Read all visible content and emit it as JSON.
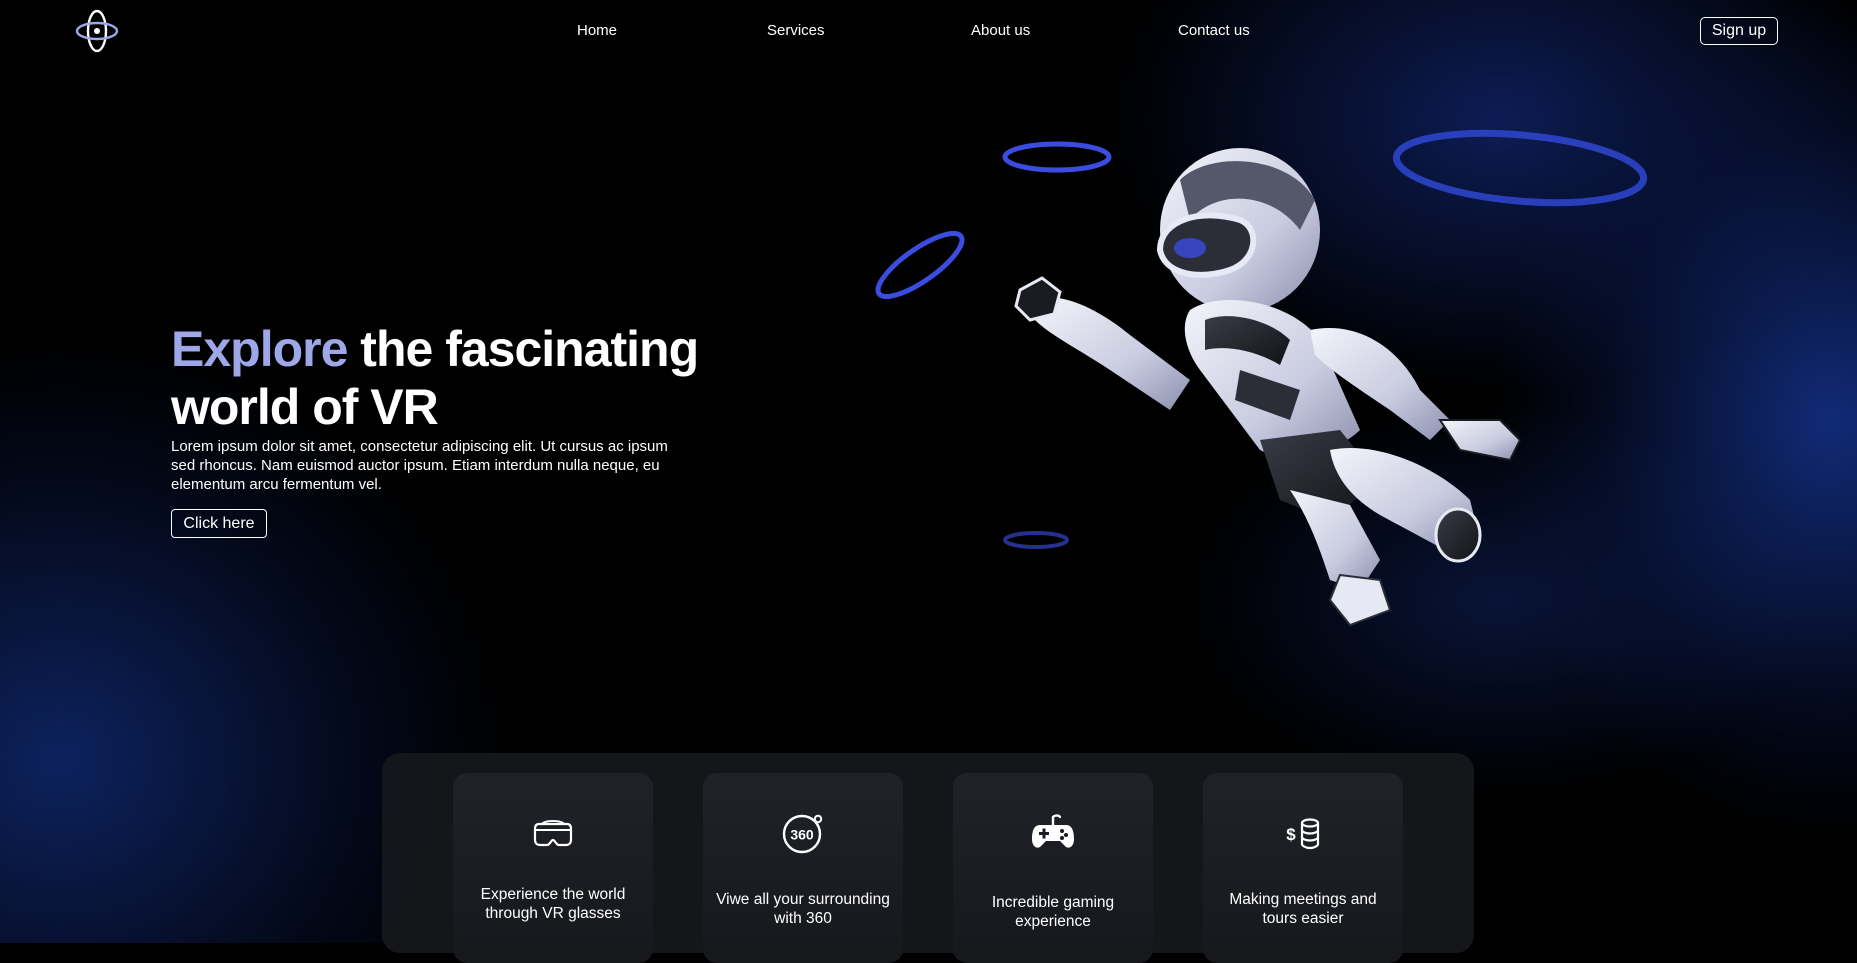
{
  "header": {
    "logo_icon": "orbit-logo-icon",
    "nav": [
      {
        "label": "Home"
      },
      {
        "label": "Services"
      },
      {
        "label": "About us"
      },
      {
        "label": "Contact us"
      }
    ],
    "signup_label": "Sign up"
  },
  "hero": {
    "title_accent": "Explore",
    "title_rest": " the fascinating world of VR",
    "body": "Lorem ipsum dolor sit amet, consectetur adipiscing elit. Ut cursus ac ipsum sed rhoncus. Nam euismod auctor ipsum. Etiam interdum nulla neque, eu elementum arcu fermentum vel.",
    "cta_label": "Click here",
    "illustration": "flying-robot-with-rings"
  },
  "features": [
    {
      "icon": "vr-headset-icon",
      "label": "Experience the world through VR glasses"
    },
    {
      "icon": "360-view-icon",
      "label": "Viwe all your surrounding with 360"
    },
    {
      "icon": "gamepad-icon",
      "label": "Incredible gaming experience"
    },
    {
      "icon": "money-coins-icon",
      "label": "Making meetings and tours easier"
    }
  ],
  "colors": {
    "accent": "#9ea7e8",
    "background": "#000000",
    "glow_blue": "#14328c",
    "ring_blue": "#3b4ce0",
    "card_bg": "#1f2228"
  }
}
